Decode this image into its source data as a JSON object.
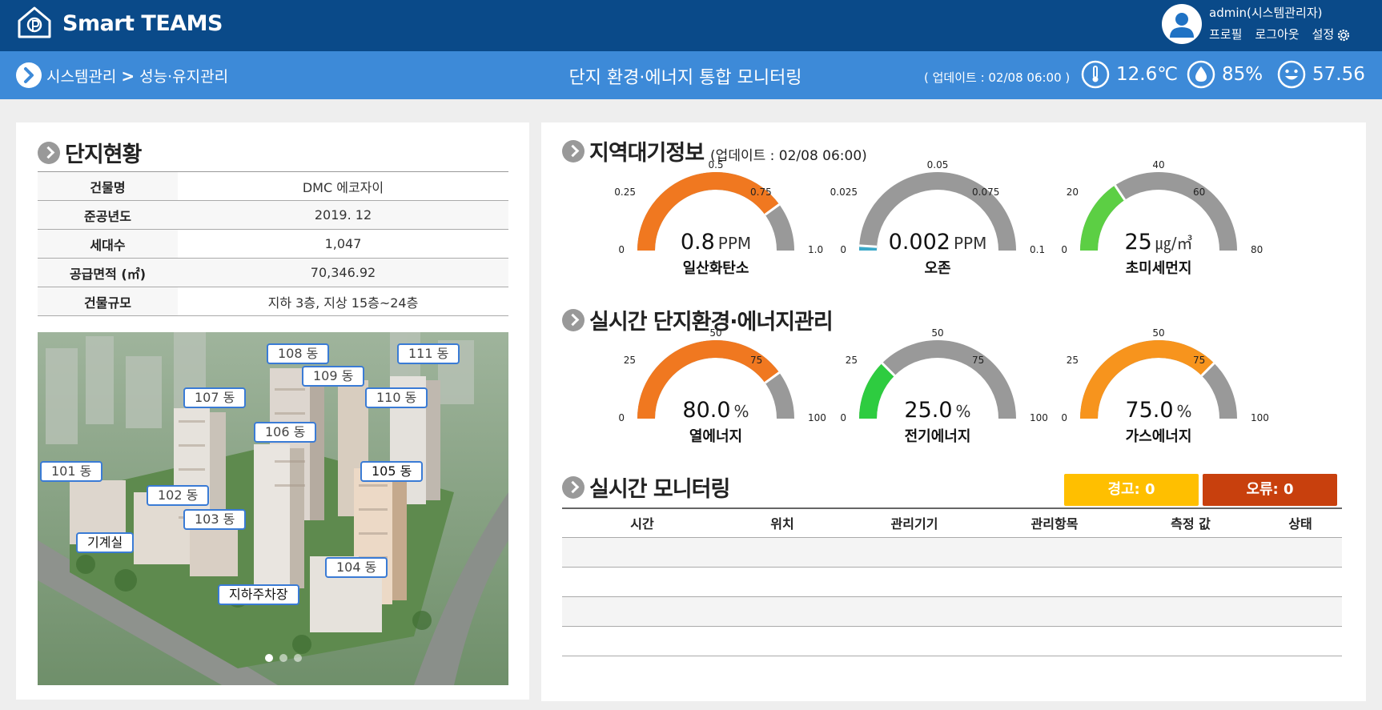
{
  "header": {
    "app_title": "Smart TEAMS",
    "user": "admin(시스템관리자)",
    "links": {
      "profile": "프로필",
      "logout": "로그아웃",
      "settings": "설정"
    }
  },
  "subbar": {
    "breadcrumb": [
      "시스템관리",
      "성능·유지관리"
    ],
    "title": "단지 환경·에너지 통합 모니터링",
    "update": "( 업데이트 : 02/08 06:00 )",
    "temperature": "12.6℃",
    "humidity": "85%",
    "comfort": "57.56"
  },
  "complex": {
    "title": "단지현황",
    "rows": [
      {
        "k": "건물명",
        "v": "DMC 에코자이"
      },
      {
        "k": "준공년도",
        "v": "2019. 12"
      },
      {
        "k": "세대수",
        "v": "1,047"
      },
      {
        "k": "공급면적 (㎡)",
        "v": "70,346.92"
      },
      {
        "k": "건물규모",
        "v": "지하 3층, 지상 15층~24층"
      }
    ],
    "tags": {
      "b108": "108 동",
      "b111": "111 동",
      "b109": "109 동",
      "b107": "107 동",
      "b110": "110 동",
      "b106": "106 동",
      "b101": "101 동",
      "b105": "105 동",
      "b102": "102 동",
      "b103": "103 동",
      "machine": "기계실",
      "b104": "104 동",
      "parking": "지하주차장"
    }
  },
  "air": {
    "title": "지역대기정보",
    "update": "(업데이트 : 02/08 06:00)",
    "gauges": [
      {
        "label": "일산화탄소",
        "value_text": "0.8",
        "unit": "PPM",
        "min": 0,
        "max": 1.0,
        "value": 0.8,
        "color": "#f07820",
        "ticks": [
          "0",
          "0.25",
          "0.5",
          "0.75",
          "1.0"
        ]
      },
      {
        "label": "오존",
        "value_text": "0.002",
        "unit": "PPM",
        "min": 0,
        "max": 0.1,
        "value": 0.002,
        "color": "#3aa8c8",
        "ticks": [
          "0",
          "0.025",
          "0.05",
          "0.075",
          "0.1"
        ]
      },
      {
        "label": "초미세먼지",
        "value_text": "25",
        "unit": "㎍/㎥",
        "min": 0,
        "max": 80,
        "value": 25,
        "color": "#5ccf44",
        "ticks": [
          "0",
          "20",
          "40",
          "60",
          "80"
        ]
      }
    ]
  },
  "energy": {
    "title": "실시간 단지환경·에너지관리",
    "gauges": [
      {
        "label": "열에너지",
        "value_text": "80.0",
        "unit": "%",
        "min": 0,
        "max": 100,
        "value": 80,
        "color": "#f07820",
        "ticks": [
          "0",
          "25",
          "50",
          "75",
          "100"
        ]
      },
      {
        "label": "전기에너지",
        "value_text": "25.0",
        "unit": "%",
        "min": 0,
        "max": 100,
        "value": 25,
        "color": "#2ecc40",
        "ticks": [
          "0",
          "25",
          "50",
          "75",
          "100"
        ]
      },
      {
        "label": "가스에너지",
        "value_text": "75.0",
        "unit": "%",
        "min": 0,
        "max": 100,
        "value": 75,
        "color": "#f7941d",
        "ticks": [
          "0",
          "25",
          "50",
          "75",
          "100"
        ]
      }
    ]
  },
  "monitor": {
    "title": "실시간 모니터링",
    "warn": "경고: 0",
    "error": "오류: 0",
    "columns": [
      "시간",
      "위치",
      "관리기기",
      "관리항목",
      "측정 값",
      "상태"
    ]
  },
  "colors": {
    "header": "#0a4a89",
    "subbar": "#3d8ad8",
    "track": "#999999"
  }
}
